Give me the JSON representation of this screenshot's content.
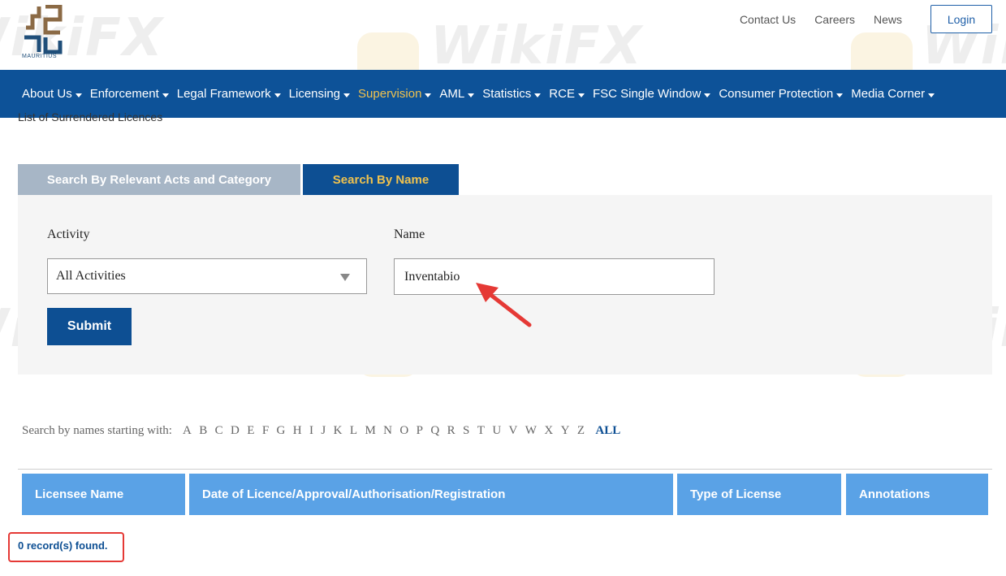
{
  "header": {
    "logo_caption": "MAURITIUS",
    "links": [
      "Contact Us",
      "Careers",
      "News"
    ],
    "login_label": "Login"
  },
  "nav": {
    "items": [
      {
        "label": "About Us",
        "active": false
      },
      {
        "label": "Enforcement",
        "active": false
      },
      {
        "label": "Legal Framework",
        "active": false
      },
      {
        "label": "Licensing",
        "active": false
      },
      {
        "label": "Supervision",
        "active": true
      },
      {
        "label": "AML",
        "active": false
      },
      {
        "label": "Statistics",
        "active": false
      },
      {
        "label": "RCE",
        "active": false
      },
      {
        "label": "FSC Single Window",
        "active": false
      },
      {
        "label": "Consumer Protection",
        "active": false
      },
      {
        "label": "Media Corner",
        "active": false
      }
    ]
  },
  "breadcrumb": "List of Surrendered Licences",
  "tabs": {
    "acts": "Search By Relevant Acts and Category",
    "name": "Search By Name"
  },
  "form": {
    "activity_label": "Activity",
    "activity_value": "All Activities",
    "name_label": "Name",
    "name_value": "Inventabio",
    "submit_label": "Submit"
  },
  "alphabet": {
    "label": "Search by names starting with:",
    "letters": [
      "A",
      "B",
      "C",
      "D",
      "E",
      "F",
      "G",
      "H",
      "I",
      "J",
      "K",
      "L",
      "M",
      "N",
      "O",
      "P",
      "Q",
      "R",
      "S",
      "T",
      "U",
      "V",
      "W",
      "X",
      "Y",
      "Z"
    ],
    "all_label": "ALL"
  },
  "table": {
    "columns": [
      "Licensee Name",
      "Date of Licence/Approval/Authorisation/Registration",
      "Type of License",
      "Annotations"
    ]
  },
  "results": {
    "records_text": "0 record(s) found."
  },
  "watermark": "WikiFX",
  "colors": {
    "nav_bg": "#0d5298",
    "active_nav": "#f0c24e",
    "table_header": "#5aa2e6",
    "annotation_red": "#e53935"
  }
}
